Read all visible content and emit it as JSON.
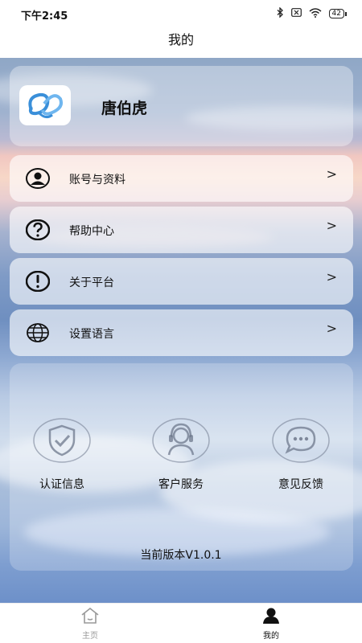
{
  "status": {
    "time": "下午2:45",
    "battery": "42"
  },
  "header": {
    "title": "我的"
  },
  "profile": {
    "name": "唐伯虎"
  },
  "menu": [
    {
      "label": "账号与资料",
      "icon": "user-circle-icon"
    },
    {
      "label": "帮助中心",
      "icon": "question-circle-icon"
    },
    {
      "label": "关于平台",
      "icon": "exclamation-circle-icon"
    },
    {
      "label": "设置语言",
      "icon": "globe-icon"
    }
  ],
  "services": [
    {
      "label": "认证信息",
      "icon": "shield-check-icon"
    },
    {
      "label": "客户服务",
      "icon": "headset-agent-icon"
    },
    {
      "label": "意见反馈",
      "icon": "chat-bubble-icon"
    }
  ],
  "version": "当前版本V1.0.1",
  "tabs": [
    {
      "label": "主页",
      "icon": "home-icon",
      "active": false
    },
    {
      "label": "我的",
      "icon": "person-icon",
      "active": true
    }
  ],
  "colors": {
    "accent_text": "#111111",
    "inactive_tab": "#999999",
    "card_tint": "#ffffff"
  }
}
